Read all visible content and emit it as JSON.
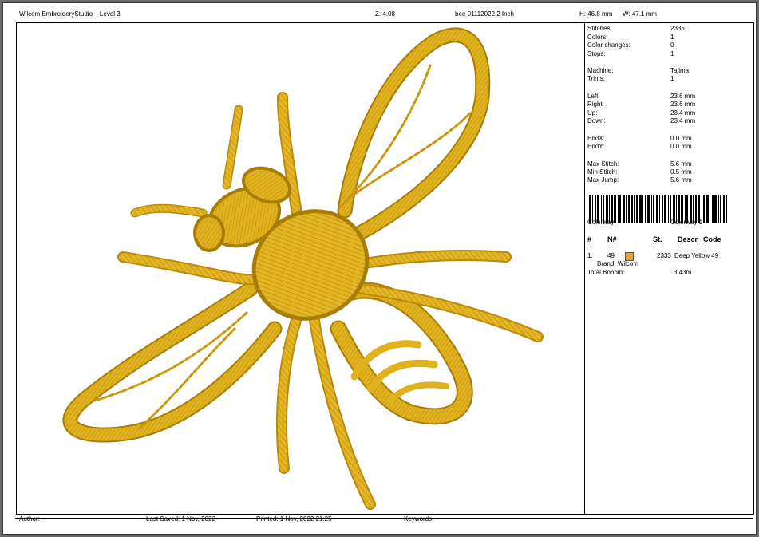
{
  "header": {
    "app_title": "Wilcom EmbroideryStudio – Level 3",
    "zoom": "Z: 4.08",
    "filename": "bee 01112022 2  Inch",
    "height": "H: 46.8 mm",
    "width": "W: 47.1 mm"
  },
  "stats": [
    {
      "label": "Stitches:",
      "value": "2335"
    },
    {
      "label": "Colors:",
      "value": "1"
    },
    {
      "label": "Color changes:",
      "value": "0"
    },
    {
      "label": "Stops:",
      "value": "1"
    },
    {
      "label": "Machine:",
      "value": "Tajima"
    },
    {
      "label": "Trims:",
      "value": "1"
    },
    {
      "label": "Left:",
      "value": "23.6 mm"
    },
    {
      "label": "Right:",
      "value": "23.6 mm"
    },
    {
      "label": "Up:",
      "value": "23.4 mm"
    },
    {
      "label": "Down:",
      "value": "23.4 mm"
    },
    {
      "label": "EndX:",
      "value": "0.0 mm"
    },
    {
      "label": "EndY:",
      "value": "0.0 mm"
    },
    {
      "label": "Max Stitch:",
      "value": "5.6 mm"
    },
    {
      "label": "Min Stitch:",
      "value": "0.5 mm"
    },
    {
      "label": "Max Jump:",
      "value": "5.6 mm"
    }
  ],
  "colorway": {
    "label": "Colorway:",
    "value": "Colorway 1"
  },
  "color_table": {
    "headers": {
      "num": "#",
      "n": "N#",
      "st": "St.",
      "descr": "Descr",
      "code": "Code"
    },
    "rows": [
      {
        "index": "1.",
        "n": "49",
        "st": "2333",
        "descr": "Deep Yellow 49",
        "brand": "Brand: Wilcom",
        "swatch_color": "#e9a53a"
      }
    ],
    "total_bobbin_label": "Total Bobbin:",
    "total_bobbin_value": "3.43m"
  },
  "footer": {
    "author": "Author:",
    "last_saved": "Last Saved:  1 Nov, 2022",
    "printed": "Printed:  1 Nov, 2022 21:25",
    "keywords": "Keywords:"
  },
  "colors": {
    "thread": "#e0b21e",
    "thread_dark": "#a77d08",
    "thread_light": "#f6d85a"
  }
}
